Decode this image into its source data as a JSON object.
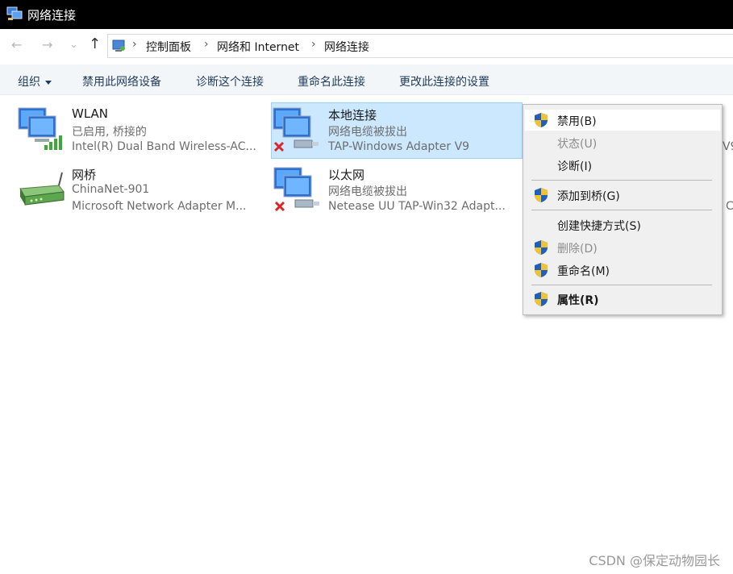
{
  "window": {
    "title": "网络连接"
  },
  "nav": {
    "back": "←",
    "forward": "→",
    "history": "⌄",
    "up": "↑"
  },
  "breadcrumb": {
    "items": [
      "控制面板",
      "网络和 Internet",
      "网络连接"
    ],
    "separator": "›"
  },
  "toolbar": {
    "organize": "组织",
    "commands": [
      "禁用此网络设备",
      "诊断这个连接",
      "重命名此连接",
      "更改此连接的设置"
    ]
  },
  "connections": [
    {
      "name": "WLAN",
      "status": "已启用, 桥接的",
      "device": "Intel(R) Dual Band Wireless-AC...",
      "icon": "wifi-adapter-icon",
      "selected": false
    },
    {
      "name": "本地连接",
      "status": "网络电缆被拔出",
      "device": "TAP-Windows Adapter V9",
      "icon": "ethernet-disconnected-icon",
      "selected": true
    },
    {
      "name": "网桥",
      "status": "ChinaNet-901",
      "device": "Microsoft Network Adapter M...",
      "icon": "router-icon",
      "selected": false
    },
    {
      "name": "以太网",
      "status": "网络电缆被拔出",
      "device": "Netease UU TAP-Win32 Adapt...",
      "icon": "ethernet-disconnected-icon",
      "selected": false
    }
  ],
  "clipped_fragments": {
    "row1": "V9",
    "row2": "C"
  },
  "context_menu": {
    "items": [
      {
        "label": "禁用(B)",
        "shield": true,
        "disabled": false,
        "bold": false,
        "hover": true
      },
      {
        "label": "状态(U)",
        "shield": false,
        "disabled": true,
        "bold": false,
        "hover": false
      },
      {
        "label": "诊断(I)",
        "shield": false,
        "disabled": false,
        "bold": false,
        "hover": false
      },
      {
        "label": "添加到桥(G)",
        "shield": true,
        "disabled": false,
        "bold": false,
        "hover": false
      },
      {
        "label": "创建快捷方式(S)",
        "shield": false,
        "disabled": false,
        "bold": false,
        "hover": false
      },
      {
        "label": "删除(D)",
        "shield": true,
        "disabled": true,
        "bold": false,
        "hover": false
      },
      {
        "label": "重命名(M)",
        "shield": true,
        "disabled": false,
        "bold": false,
        "hover": false
      },
      {
        "label": "属性(R)",
        "shield": true,
        "disabled": false,
        "bold": true,
        "hover": false
      }
    ]
  },
  "watermark": "CSDN @保定动物园长",
  "colors": {
    "titlebar": "#000000",
    "selection": "#cce8ff",
    "selection_border": "#99d1ff",
    "menu_bg": "#f0f0f0",
    "shield_blue": "#1f5fbf",
    "shield_yellow": "#f2c230",
    "error_red": "#d9262a"
  }
}
